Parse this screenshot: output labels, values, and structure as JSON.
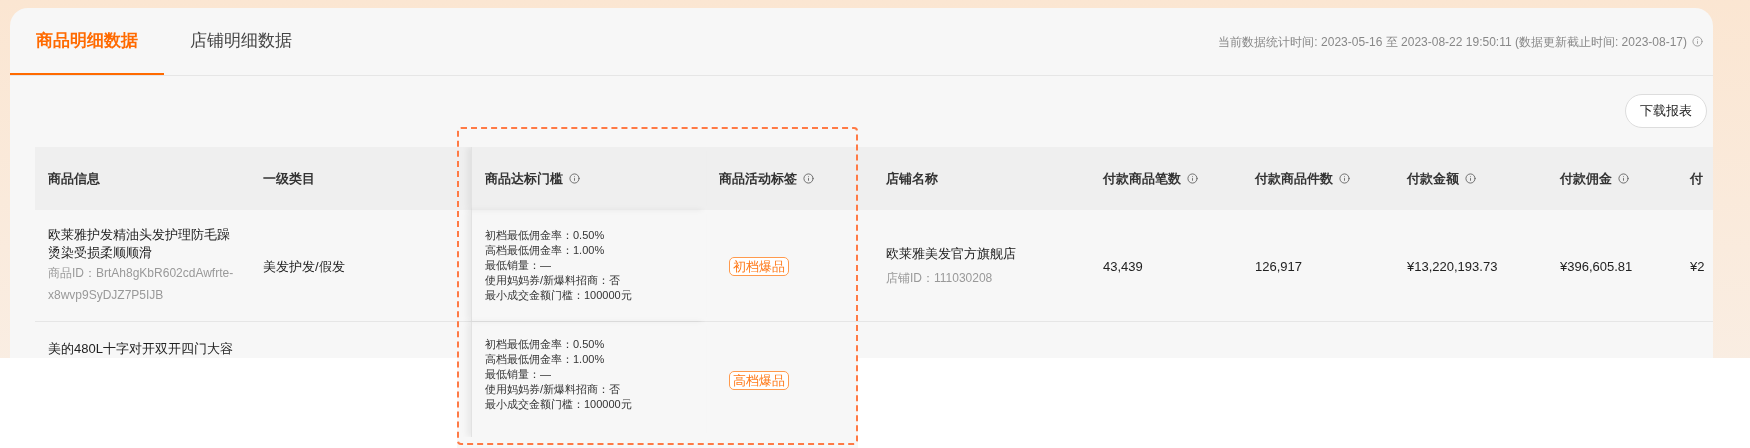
{
  "tabs": [
    {
      "label": "商品明细数据",
      "selected": true
    },
    {
      "label": "店铺明细数据",
      "selected": false
    }
  ],
  "stats_time": "当前数据统计时间: 2023-05-16 至 2023-08-22 19:50:11 (数据更新截止时间: 2023-08-17)",
  "download_button": "下载报表",
  "table": {
    "columns": [
      {
        "label": "商品信息",
        "info": false
      },
      {
        "label": "一级类目",
        "info": false
      },
      {
        "label": "商品达标门槛",
        "info": true
      },
      {
        "label": "商品活动标签",
        "info": true
      },
      {
        "label": "店铺名称",
        "info": false
      },
      {
        "label": "付款商品笔数",
        "info": true
      },
      {
        "label": "付款商品件数",
        "info": true
      },
      {
        "label": "付款金额",
        "info": true
      },
      {
        "label": "付款佣金",
        "info": true
      },
      {
        "label": "付",
        "info": false
      }
    ],
    "rows": [
      {
        "product_name": "欧莱雅护发精油头发护理防毛躁烫染受损柔顺顺滑",
        "product_id": "商品ID：BrtAh8gKbR602cdAwfrte-x8wvp9SyDJZ7P5IJB",
        "category": "美发护发/假发",
        "threshold": [
          "初档最低佣金率：0.50%",
          "高档最低佣金率：1.00%",
          "最低销量：—",
          "使用妈妈券/新爆料招商：否",
          "最小成交金额门槛：100000元"
        ],
        "tag": "初档爆品",
        "store_name": "欧莱雅美发官方旗舰店",
        "store_id": "店铺ID：111030208",
        "values": [
          "43,439",
          "126,917",
          "¥13,220,193.73",
          "¥396,605.81",
          "¥2"
        ]
      },
      {
        "product_name": "美的480L十字对开双开四门大容",
        "threshold": [
          "初档最低佣金率：0.50%",
          "高档最低佣金率：1.00%",
          "最低销量：—",
          "使用妈妈券/新爆料招商：否",
          "最小成交金额门槛：100000元"
        ],
        "tag": "高档爆品"
      }
    ]
  }
}
